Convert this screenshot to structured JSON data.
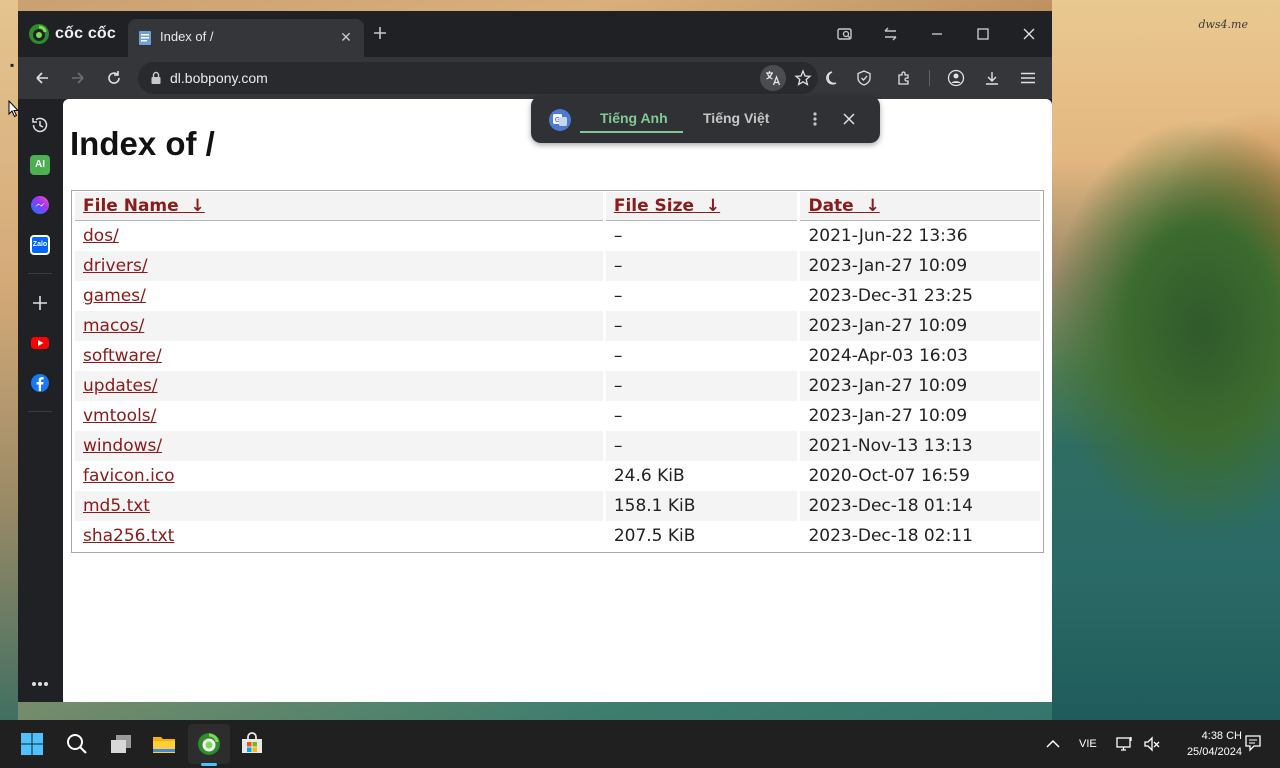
{
  "desktop": {
    "watermark": "dws4.me"
  },
  "browser": {
    "brand": "cốc cốc",
    "tab": {
      "title": "Index of /",
      "close_glyph": "✕"
    },
    "url": "dl.bobpony.com"
  },
  "translate_popup": {
    "source_lang": "Tiếng Anh",
    "target_lang": "Tiếng Việt"
  },
  "page": {
    "title": "Index of /",
    "columns": [
      {
        "label": "File Name",
        "sort_arrow": "↓"
      },
      {
        "label": "File Size",
        "sort_arrow": "↓"
      },
      {
        "label": "Date",
        "sort_arrow": "↓"
      }
    ],
    "rows": [
      {
        "name": "dos/",
        "size": "–",
        "date": "2021-Jun-22 13:36"
      },
      {
        "name": "drivers/",
        "size": "–",
        "date": "2023-Jan-27 10:09"
      },
      {
        "name": "games/",
        "size": "–",
        "date": "2023-Dec-31 23:25"
      },
      {
        "name": "macos/",
        "size": "–",
        "date": "2023-Jan-27 10:09"
      },
      {
        "name": "software/",
        "size": "–",
        "date": "2024-Apr-03 16:03"
      },
      {
        "name": "updates/",
        "size": "–",
        "date": "2023-Jan-27 10:09"
      },
      {
        "name": "vmtools/",
        "size": "–",
        "date": "2023-Jan-27 10:09"
      },
      {
        "name": "windows/",
        "size": "–",
        "date": "2021-Nov-13 13:13"
      },
      {
        "name": "favicon.ico",
        "size": "24.6 KiB",
        "date": "2020-Oct-07 16:59"
      },
      {
        "name": "md5.txt",
        "size": "158.1 KiB",
        "date": "2023-Dec-18 01:14"
      },
      {
        "name": "sha256.txt",
        "size": "207.5 KiB",
        "date": "2023-Dec-18 02:11"
      }
    ]
  },
  "sidebar": {
    "items": [
      "history-icon",
      "ai-icon",
      "messenger-icon",
      "zalo-icon",
      "add-icon",
      "youtube-icon",
      "facebook-icon"
    ],
    "ai_label": "AI",
    "zalo_label": "Zalo"
  },
  "taskbar": {
    "apps": [
      "start-icon",
      "search-icon",
      "task-view-icon",
      "file-explorer-icon",
      "coccoc-icon",
      "store-icon"
    ],
    "language": "VIE",
    "time": "4:38 CH",
    "date": "25/04/2024"
  },
  "colors": {
    "link": "#8b1a1a",
    "translate_active": "#81c995",
    "taskbar_accent": "#4cc2ff"
  }
}
